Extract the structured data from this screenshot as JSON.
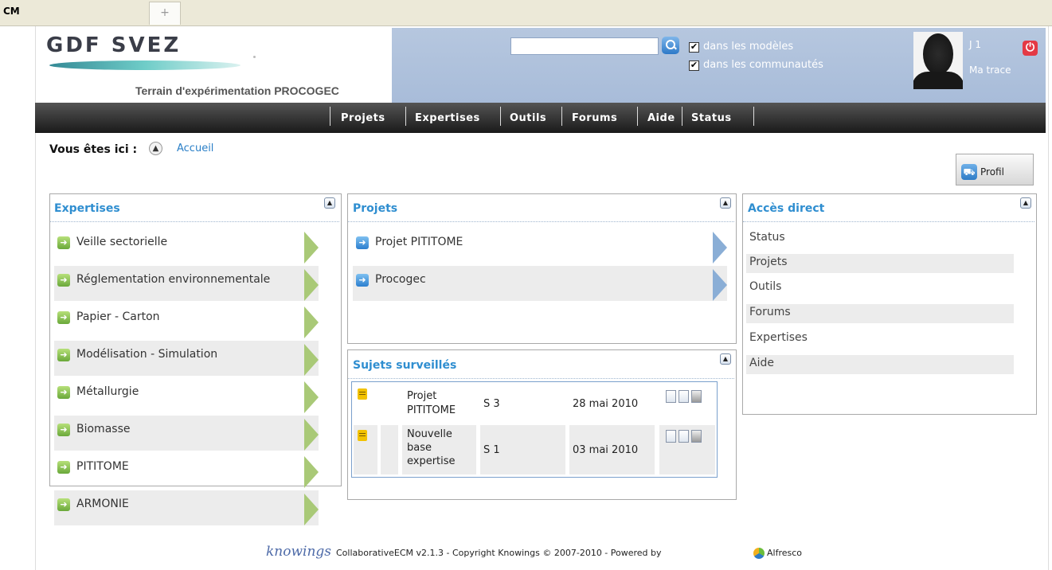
{
  "browser": {
    "tab_label": "CM",
    "new_tab_symbol": "+"
  },
  "header": {
    "logo_text": "GDF SVEZ",
    "subtitle": "Terrain d'expérimentation PROCOGEC",
    "search_placeholder": "",
    "check_models_label": "dans les modèles",
    "check_communities_label": "dans les communautés",
    "user_name": "J 1",
    "ma_trace_label": "Ma trace"
  },
  "nav": [
    "Projets",
    "Expertises",
    "Outils",
    "Forums",
    "Aide",
    "Status"
  ],
  "breadcrumb": {
    "label": "Vous êtes ici :",
    "home": "Accueil"
  },
  "profil_label": "Profil",
  "expertises": {
    "title": "Expertises",
    "items": [
      "Veille sectorielle",
      "Réglementation environnementale",
      "Papier - Carton",
      "Modélisation - Simulation",
      "Métallurgie",
      "Biomasse",
      "PITITOME",
      "ARMONIE"
    ]
  },
  "projets": {
    "title": "Projets",
    "items": [
      "Projet PITITOME",
      "Procogec"
    ]
  },
  "sujets": {
    "title": "Sujets surveillés",
    "rows": [
      {
        "name_l1": "Projet",
        "name_l2": "PITITOME",
        "name_l3": "",
        "code": "S 3",
        "date": "28 mai 2010"
      },
      {
        "name_l1": "Nouvelle",
        "name_l2": "base",
        "name_l3": "expertise",
        "code": "S 1",
        "date": "03 mai 2010"
      }
    ]
  },
  "acces_direct": {
    "title": "Accès direct",
    "items": [
      "Status",
      "Projets",
      "Outils",
      "Forums",
      "Expertises",
      "Aide"
    ]
  },
  "footer": {
    "logo": "knowings",
    "text": "CollaborativeECM v2.1.3 - Copyright Knowings © 2007-2010 - Powered by",
    "alfresco": "Alfresco"
  },
  "colors": {
    "title_blue": "#2f8ed0",
    "header_blue": "#b6c7df",
    "nav_dark": "#2b2b2b"
  }
}
